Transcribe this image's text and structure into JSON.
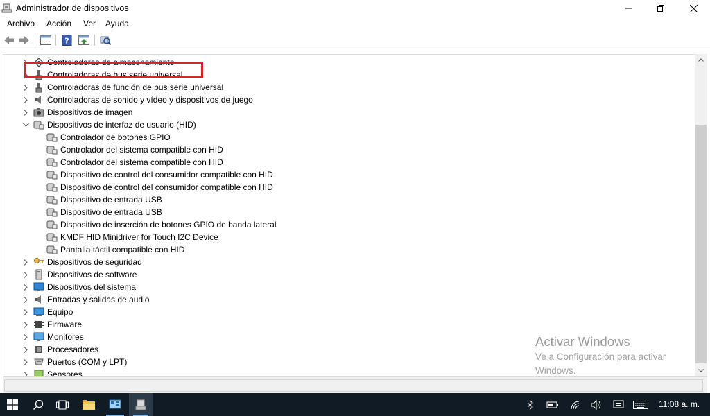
{
  "window": {
    "title": "Administrador de dispositivos",
    "controls": [
      "minimize",
      "maximize",
      "close"
    ]
  },
  "menu": {
    "items": [
      "Archivo",
      "Acción",
      "Ver",
      "Ayuda"
    ]
  },
  "toolbar": {
    "buttons": [
      "back-icon",
      "forward-icon",
      "properties-icon",
      "help-icon",
      "update-driver-icon",
      "scan-hardware-icon"
    ]
  },
  "tree": {
    "categories_top": [
      "Controladoras de almacenamiento",
      "Controladoras de bus serie universal",
      "Controladoras de función de bus serie universal",
      "Controladoras de sonido y vídeo y dispositivos de juego",
      "Dispositivos de imagen"
    ],
    "expanded": {
      "label": "Dispositivos de interfaz de usuario (HID)",
      "children": [
        "Controlador de botones GPIO",
        "Controlador del sistema compatible con HID",
        "Controlador del sistema compatible con HID",
        "Dispositivo de control del consumidor compatible con HID",
        "Dispositivo de control del consumidor compatible con HID",
        "Dispositivo de entrada USB",
        "Dispositivo de entrada USB",
        "Dispositivo de inserción de botones GPIO de banda lateral",
        "KMDF HID Minidriver for Touch I2C Device",
        "Pantalla táctil compatible con HID"
      ]
    },
    "categories_bottom": [
      "Dispositivos de seguridad",
      "Dispositivos de software",
      "Dispositivos del sistema",
      "Entradas y salidas de audio",
      "Equipo",
      "Firmware",
      "Monitores",
      "Procesadores",
      "Puertos (COM y LPT)",
      "Sensores"
    ]
  },
  "watermark": {
    "title": "Activar Windows",
    "line1": "Ve a Configuración para activar",
    "line2": "Windows."
  },
  "taskbar": {
    "clock": "11:08 a. m.",
    "colors": {
      "background": "#101b26",
      "accent": "#7fb6e8",
      "highlight": "#d1262e"
    }
  }
}
